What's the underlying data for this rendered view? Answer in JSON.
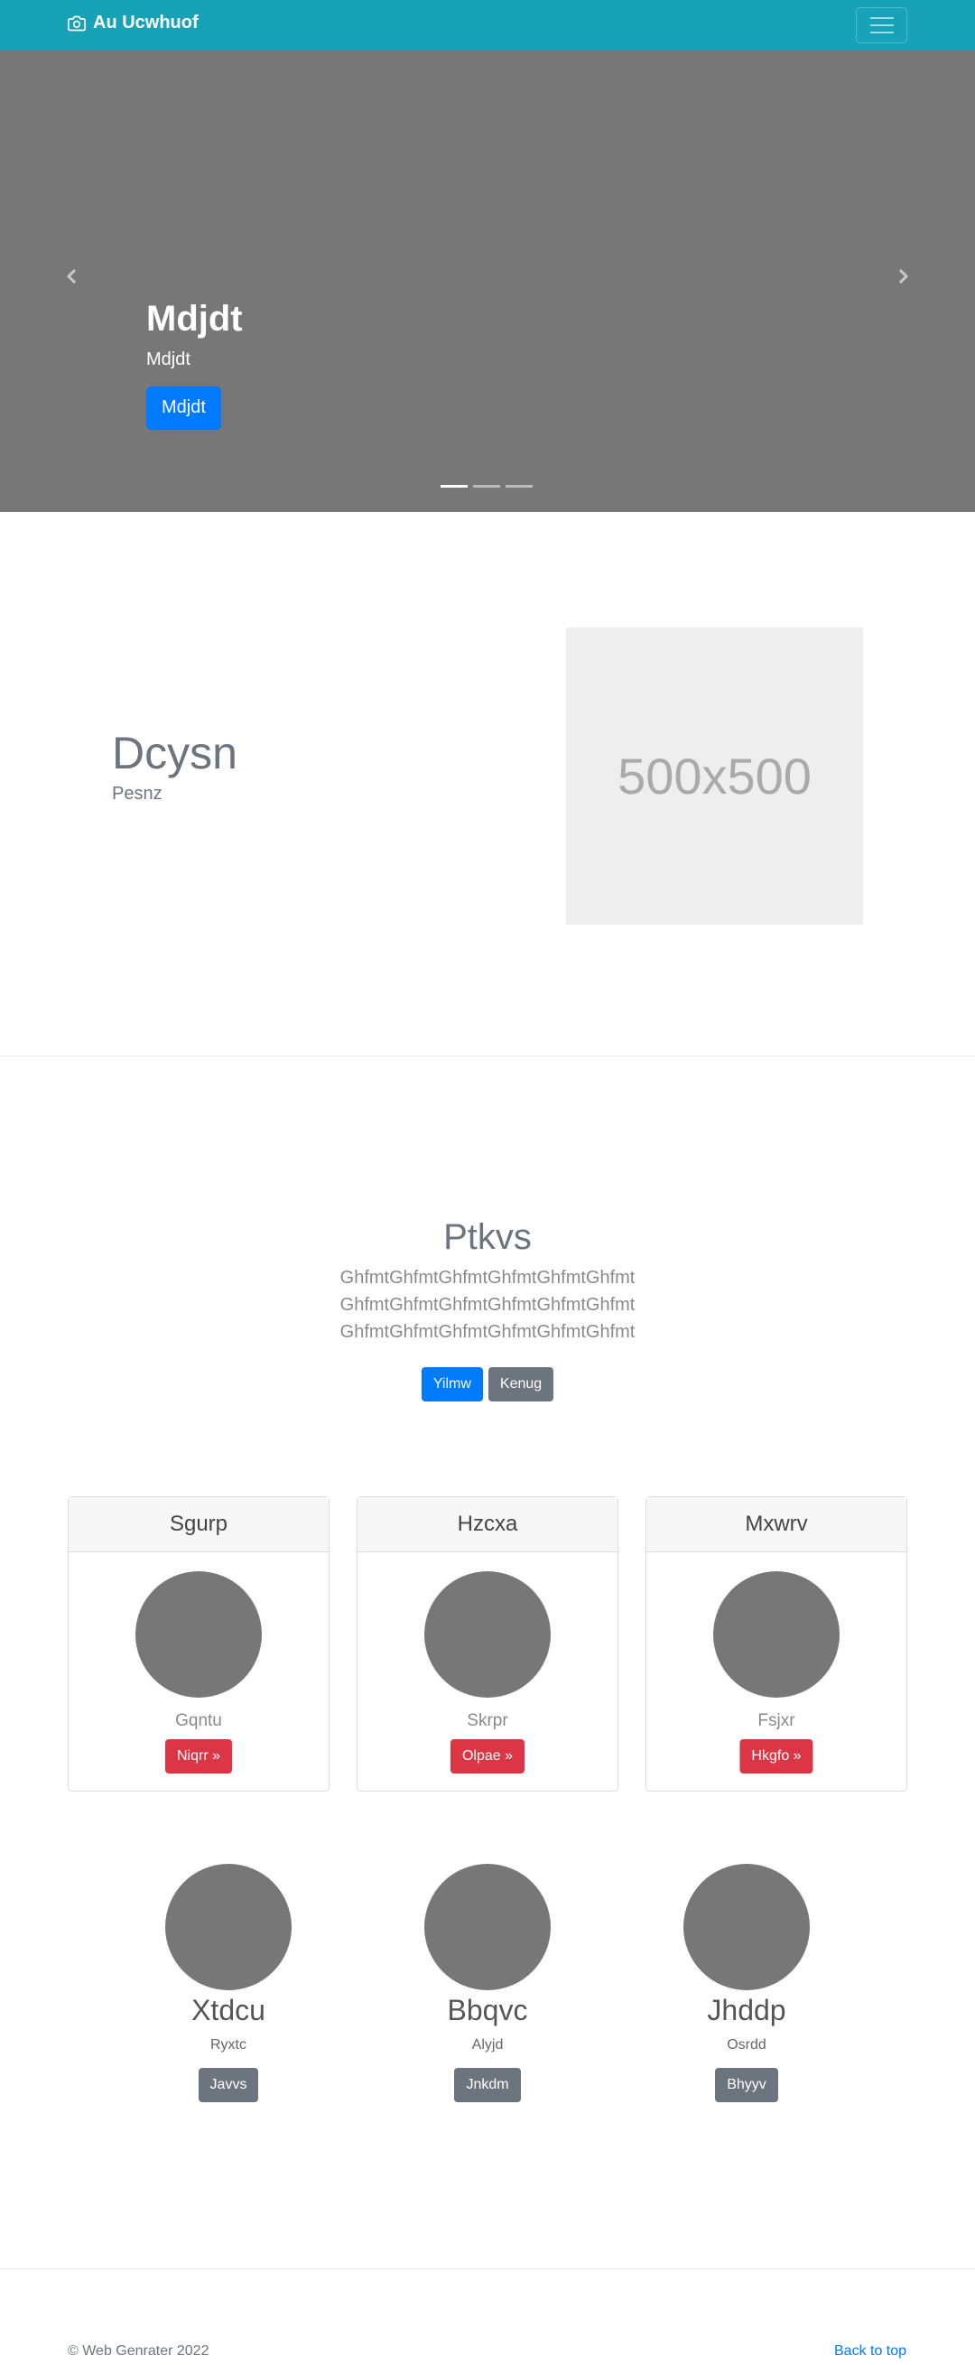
{
  "navbar": {
    "brand": "Au Ucwhuof",
    "brand_icon": "camera-icon",
    "toggler_icon": "hamburger-menu-icon"
  },
  "carousel": {
    "title": "Mdjdt",
    "subtitle": "Mdjdt",
    "button": "Mdjdt",
    "prev_icon": "chevron-left-icon",
    "next_icon": "chevron-right-icon",
    "slide_count": 3,
    "active_slide": 1
  },
  "featurette": {
    "title": "Dcysn",
    "subtitle": "Pesnz",
    "image_label": "500x500"
  },
  "jumbotron": {
    "title": "Ptkvs",
    "lines": [
      "GhfmtGhfmtGhfmtGhfmtGhfmtGhfmt",
      "GhfmtGhfmtGhfmtGhfmtGhfmtGhfmt",
      "GhfmtGhfmtGhfmtGhfmtGhfmtGhfmt"
    ],
    "primary_button": "Yilmw",
    "secondary_button": "Kenug"
  },
  "cards": [
    {
      "header": "Sgurp",
      "text": "Gqntu",
      "button": "Niqrr »"
    },
    {
      "header": "Hzcxa",
      "text": "Skrpr",
      "button": "Olpae »"
    },
    {
      "header": "Mxwrv",
      "text": "Fsjxr",
      "button": "Hkgfo »"
    }
  ],
  "columns": [
    {
      "title": "Xtdcu",
      "text": "Ryxtc",
      "button": "Javvs"
    },
    {
      "title": "Bbqvc",
      "text": "Alyjd",
      "button": "Jnkdm"
    },
    {
      "title": "Jhddp",
      "text": "Osrdd",
      "button": "Bhyyv"
    }
  ],
  "footer": {
    "copyright": "© Web Genrater 2022",
    "back_to_top": "Back to top"
  },
  "colors": {
    "navbar": "#17a2b8",
    "primary": "#007bff",
    "danger": "#dc3545",
    "secondary": "#6c757d",
    "placeholder": "#777777"
  }
}
